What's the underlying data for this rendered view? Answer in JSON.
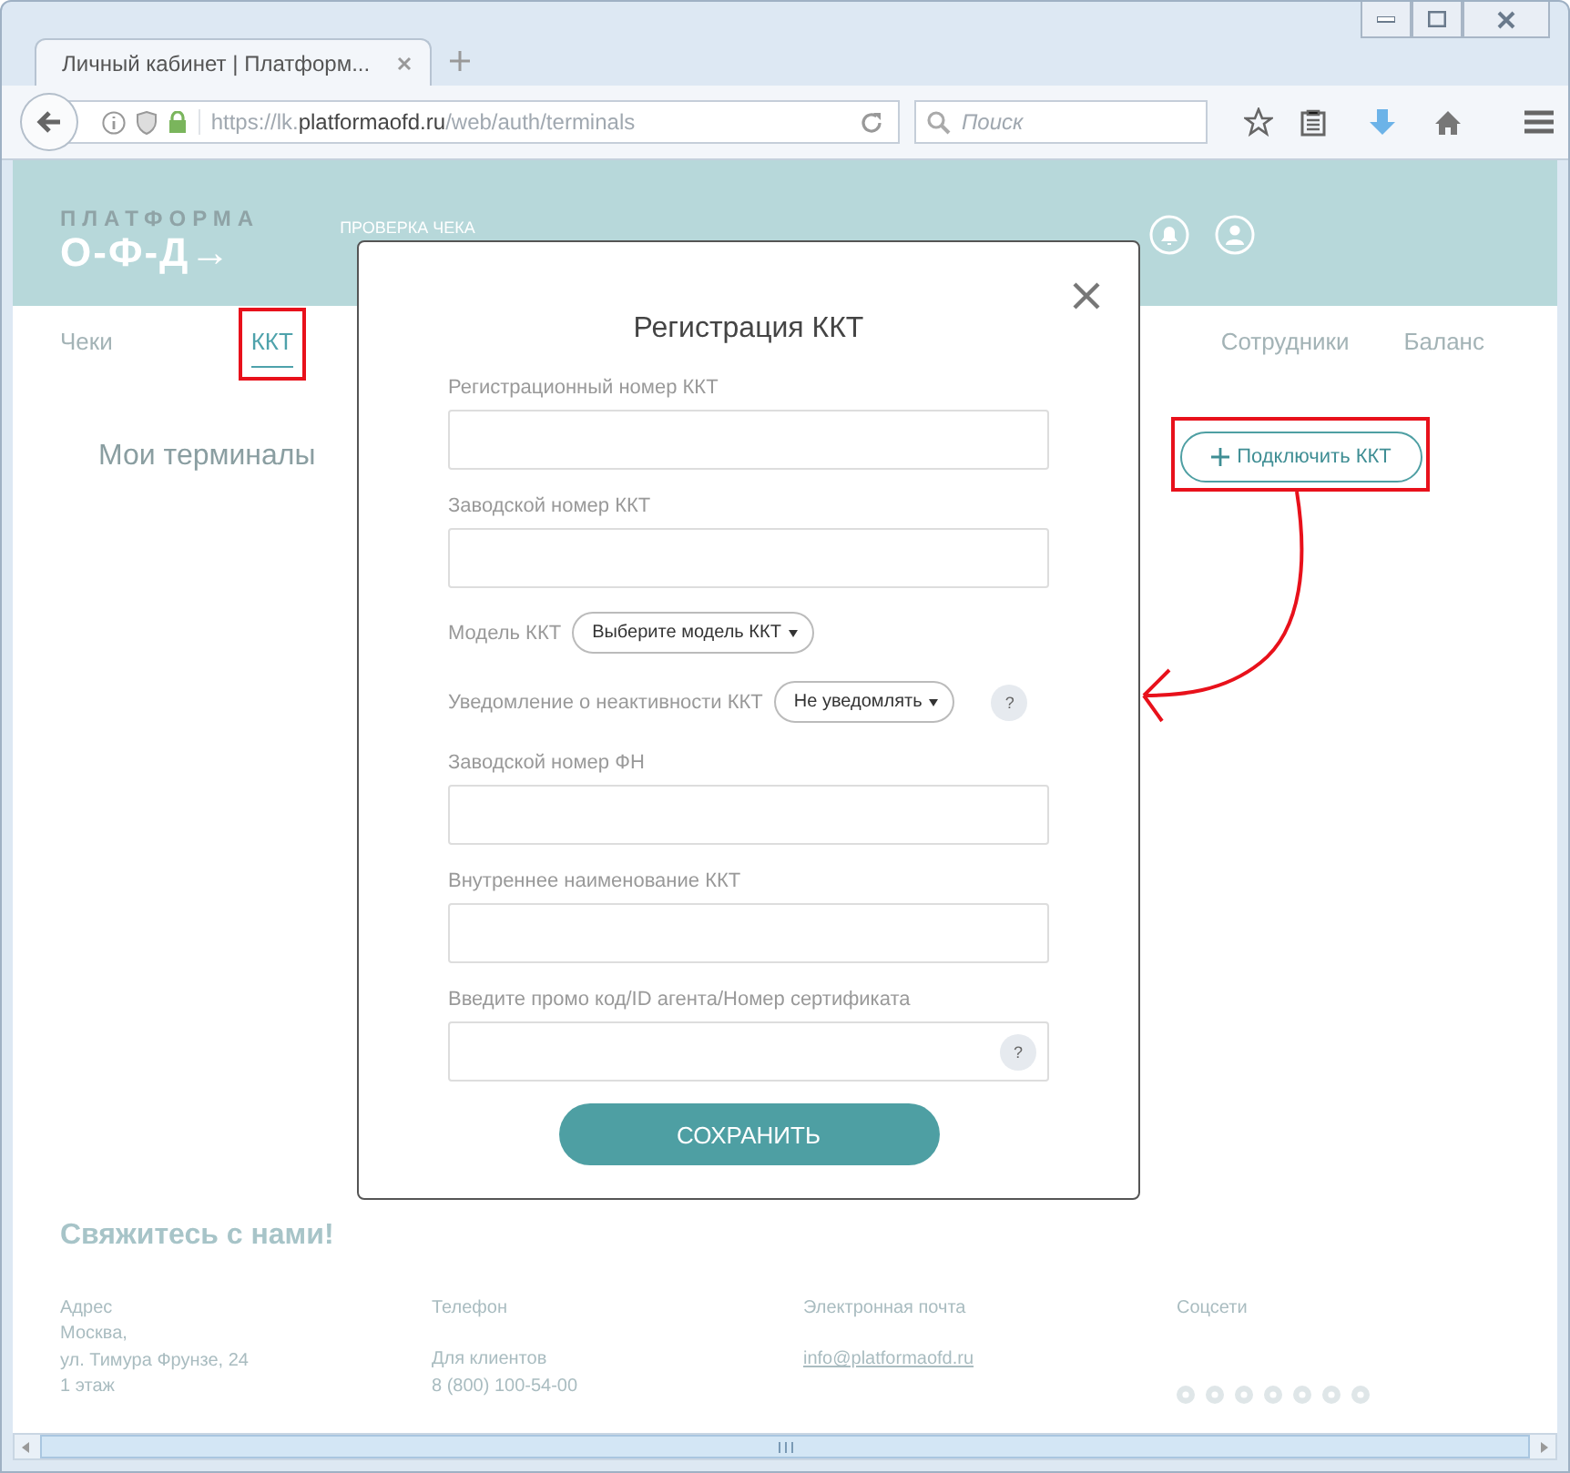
{
  "browser": {
    "tabs": [
      {
        "title": "Личный кабинет | Платформ...",
        "selected": true
      }
    ],
    "url": {
      "scheme": "https://lk.",
      "domain": "platformaofd.ru",
      "path": "/web/auth/terminals"
    },
    "search": {
      "placeholder": "Поиск"
    }
  },
  "header": {
    "logo": {
      "top": "ПЛАТФОРМА",
      "bottom": "О-Ф-Д→"
    },
    "link": "ПРОВЕРКА ЧЕКА"
  },
  "nav": [
    {
      "label": "Чеки",
      "selected": false,
      "highlighted": false
    },
    {
      "label": "ККТ",
      "selected": true,
      "highlighted": true
    },
    {
      "label": "Сотрудники",
      "selected": false,
      "highlighted": false
    },
    {
      "label": "Баланс",
      "selected": false,
      "highlighted": false
    }
  ],
  "page_title": "Мои терминалы",
  "connect_button": {
    "label": "Подключить ККТ",
    "highlighted": true
  },
  "modal": {
    "title": "Регистрация ККТ",
    "fields": [
      {
        "kind": "text",
        "label": "Регистрационный номер ККТ"
      },
      {
        "kind": "text",
        "label": "Заводской номер ККТ"
      },
      {
        "kind": "select",
        "label": "Модель ККТ",
        "value": "Выберите модель ККТ"
      },
      {
        "kind": "select",
        "label": "Уведомление о неактивности ККТ",
        "value": "Не уведомлять",
        "help": "?"
      },
      {
        "kind": "text",
        "label": "Заводской номер ФН"
      },
      {
        "kind": "text",
        "label": "Внутреннее наименование ККТ"
      },
      {
        "kind": "text",
        "label": "Введите промо код/ID агента/Номер сертификата",
        "help": "?"
      }
    ],
    "submit": "СОХРАНИТЬ"
  },
  "footer": {
    "title": "Свяжитесь с нами!",
    "columns": [
      {
        "kind": "address",
        "heading": "Адрес",
        "lines": [
          "Москва,",
          "ул. Тимура Фрунзе, 24",
          "1 этаж"
        ]
      },
      {
        "kind": "phone",
        "heading": "Телефон",
        "lines": [
          "Для клиентов",
          "8 (800) 100-54-00"
        ]
      },
      {
        "kind": "email",
        "heading": "Электронная почта",
        "link": "info@platformaofd.ru"
      },
      {
        "kind": "social",
        "heading": "Соцсети"
      }
    ]
  }
}
